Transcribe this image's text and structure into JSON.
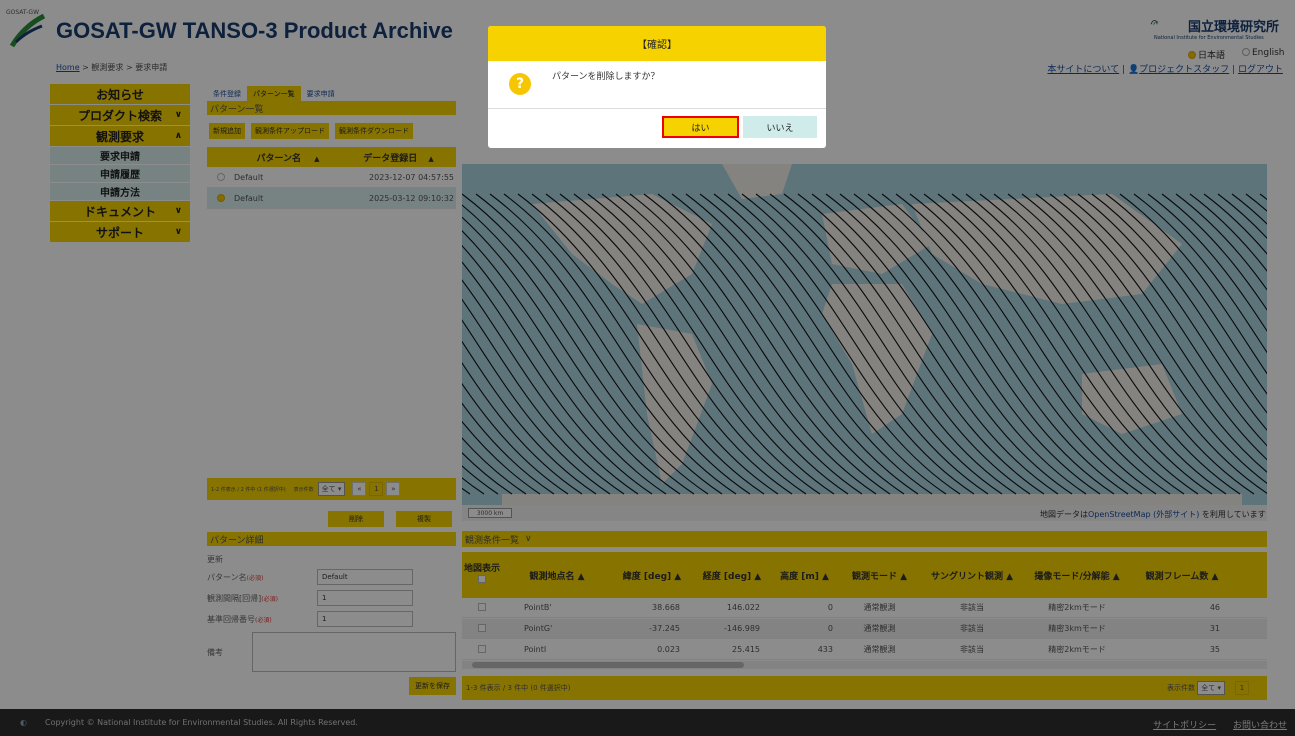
{
  "header": {
    "logo_small": "GOSAT-GW",
    "title": "GOSAT-GW TANSO-3 Product Archive",
    "breadcrumb": {
      "home": "Home",
      "sep1": ">",
      "level1": "観測要求",
      "sep2": ">",
      "level2": "要求申請"
    },
    "institute": {
      "name_jp": "国立環境研究所",
      "name_en": "National Institute for Environmental Studies"
    },
    "languages": [
      {
        "label": "日本語",
        "selected": true
      },
      {
        "label": "English",
        "selected": false
      }
    ],
    "links": {
      "about": "本サイトについて",
      "staff": "プロジェクトスタッフ",
      "logout": "ログアウト",
      "sep": "|"
    }
  },
  "nav": {
    "items": [
      {
        "label": "お知らせ",
        "chevron": ""
      },
      {
        "label": "プロダクト検索",
        "chevron": "∨"
      },
      {
        "label": "観測要求",
        "chevron": "∧"
      }
    ],
    "sub_items": [
      "要求申請",
      "申請履歴",
      "申請方法"
    ],
    "items_after": [
      {
        "label": "ドキュメント",
        "chevron": "∨"
      },
      {
        "label": "サポート",
        "chevron": "∨"
      }
    ]
  },
  "pattern_panel": {
    "tabs": [
      "条件登録",
      "パターン一覧",
      "要求申請"
    ],
    "list_title": "パターン一覧",
    "buttons": [
      "新規追加",
      "観測条件アップロード",
      "観測条件ダウンロード"
    ],
    "columns": [
      "パターン名",
      "データ登録日"
    ],
    "sort_icon": "▲",
    "rows": [
      {
        "name": "Default",
        "date": "2023-12-07 04:57:55",
        "selected": false
      },
      {
        "name": "Default",
        "date": "2025-03-12 09:10:32",
        "selected": true
      }
    ],
    "pager": {
      "summary": "1-2 件表示 / 2 件中 (1 件選択中)",
      "per_page_label": "表示件数",
      "per_page_value": "全て",
      "page": "1",
      "prev": "«",
      "next": "»"
    },
    "action_buttons": {
      "delete": "削除",
      "copy": "複製"
    }
  },
  "detail": {
    "title": "パターン詳細",
    "mode": "更新",
    "fields": [
      {
        "label": "パターン名",
        "required": "(必須)",
        "value": "Default"
      },
      {
        "label": "観測間隔[回帰]",
        "required": "(必須)",
        "value": "1"
      },
      {
        "label": "基準回帰番号",
        "required": "(必須)",
        "value": "1"
      }
    ],
    "remarks_label": "備考",
    "save_button": "更新を保存"
  },
  "map": {
    "scale": "3000 km",
    "attribution": {
      "prefix": "地図データは",
      "link": "OpenStreetMap (外部サイト)",
      "suffix": " を利用しています"
    }
  },
  "conditions": {
    "title": "観測条件一覧",
    "toggle": "∨",
    "columns": [
      "地図表示",
      "観測地点名",
      "緯度 [deg]",
      "経度 [deg]",
      "高度 [m]",
      "観測モード",
      "サングリント観測",
      "撮像モード/分解能",
      "観測フレーム数"
    ],
    "rows": [
      {
        "name": "PointB'",
        "lat": "38.668",
        "lon": "146.022",
        "alt": "0",
        "mode": "通常観測",
        "sunglint": "非該当",
        "imaging": "精密2kmモード",
        "frames": "46"
      },
      {
        "name": "PointG'",
        "lat": "-37.245",
        "lon": "-146.989",
        "alt": "0",
        "mode": "通常観測",
        "sunglint": "非該当",
        "imaging": "精密3kmモード",
        "frames": "31"
      },
      {
        "name": "PointI",
        "lat": "0.023",
        "lon": "25.415",
        "alt": "433",
        "mode": "通常観測",
        "sunglint": "非該当",
        "imaging": "精密2kmモード",
        "frames": "35"
      }
    ],
    "footer": {
      "summary": "1-3 件表示 / 3 件中 (0 件選択中)",
      "per_page_label": "表示件数",
      "per_page_value": "全て",
      "page": "1"
    }
  },
  "footer": {
    "copyright": "Copyright © National Institute for Environmental Studies. All Rights Reserved.",
    "links": [
      "サイトポリシー",
      "お問い合わせ"
    ]
  },
  "dialog": {
    "title": "【確認】",
    "message": "パターンを削除しますか？",
    "icon": "question-icon",
    "icon_glyph": "?",
    "yes": "はい",
    "no": "いいえ"
  },
  "colors": {
    "accent": "#f6d200",
    "teal": "#d7efed",
    "link": "#1a4da0",
    "water": "#aad3df",
    "land": "#f2efe9"
  }
}
